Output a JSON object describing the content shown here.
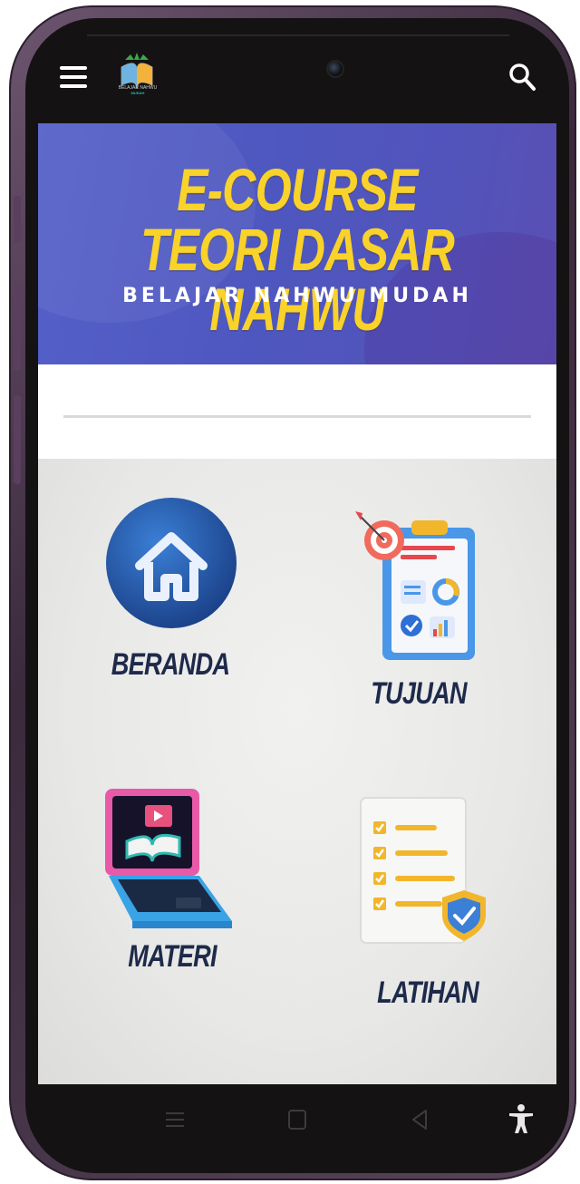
{
  "app": {
    "logo_caption": "BELAJAR NAHWU",
    "logo_sub": "MUDAH"
  },
  "banner": {
    "title_line1": "E-COURSE",
    "title_line2": "TEORI DASAR NAHWU",
    "subtitle": "BELAJAR NAHWU MUDAH"
  },
  "menu": {
    "items": [
      {
        "label": "BERANDA",
        "icon": "home-icon"
      },
      {
        "label": "TUJUAN",
        "icon": "target-clipboard-icon"
      },
      {
        "label": "MATERI",
        "icon": "laptop-book-icon"
      },
      {
        "label": "LATIHAN",
        "icon": "checklist-icon"
      }
    ]
  },
  "icons": {
    "menu": "hamburger-icon",
    "search": "search-icon",
    "nav_recent": "recent-apps-icon",
    "nav_home": "home-square-icon",
    "nav_back": "back-triangle-icon",
    "accessibility": "accessibility-icon"
  },
  "colors": {
    "banner": "#5460c8",
    "title_yellow": "#f9d22a",
    "label_navy": "#1e2a4a",
    "phone_frame": "#574459"
  }
}
